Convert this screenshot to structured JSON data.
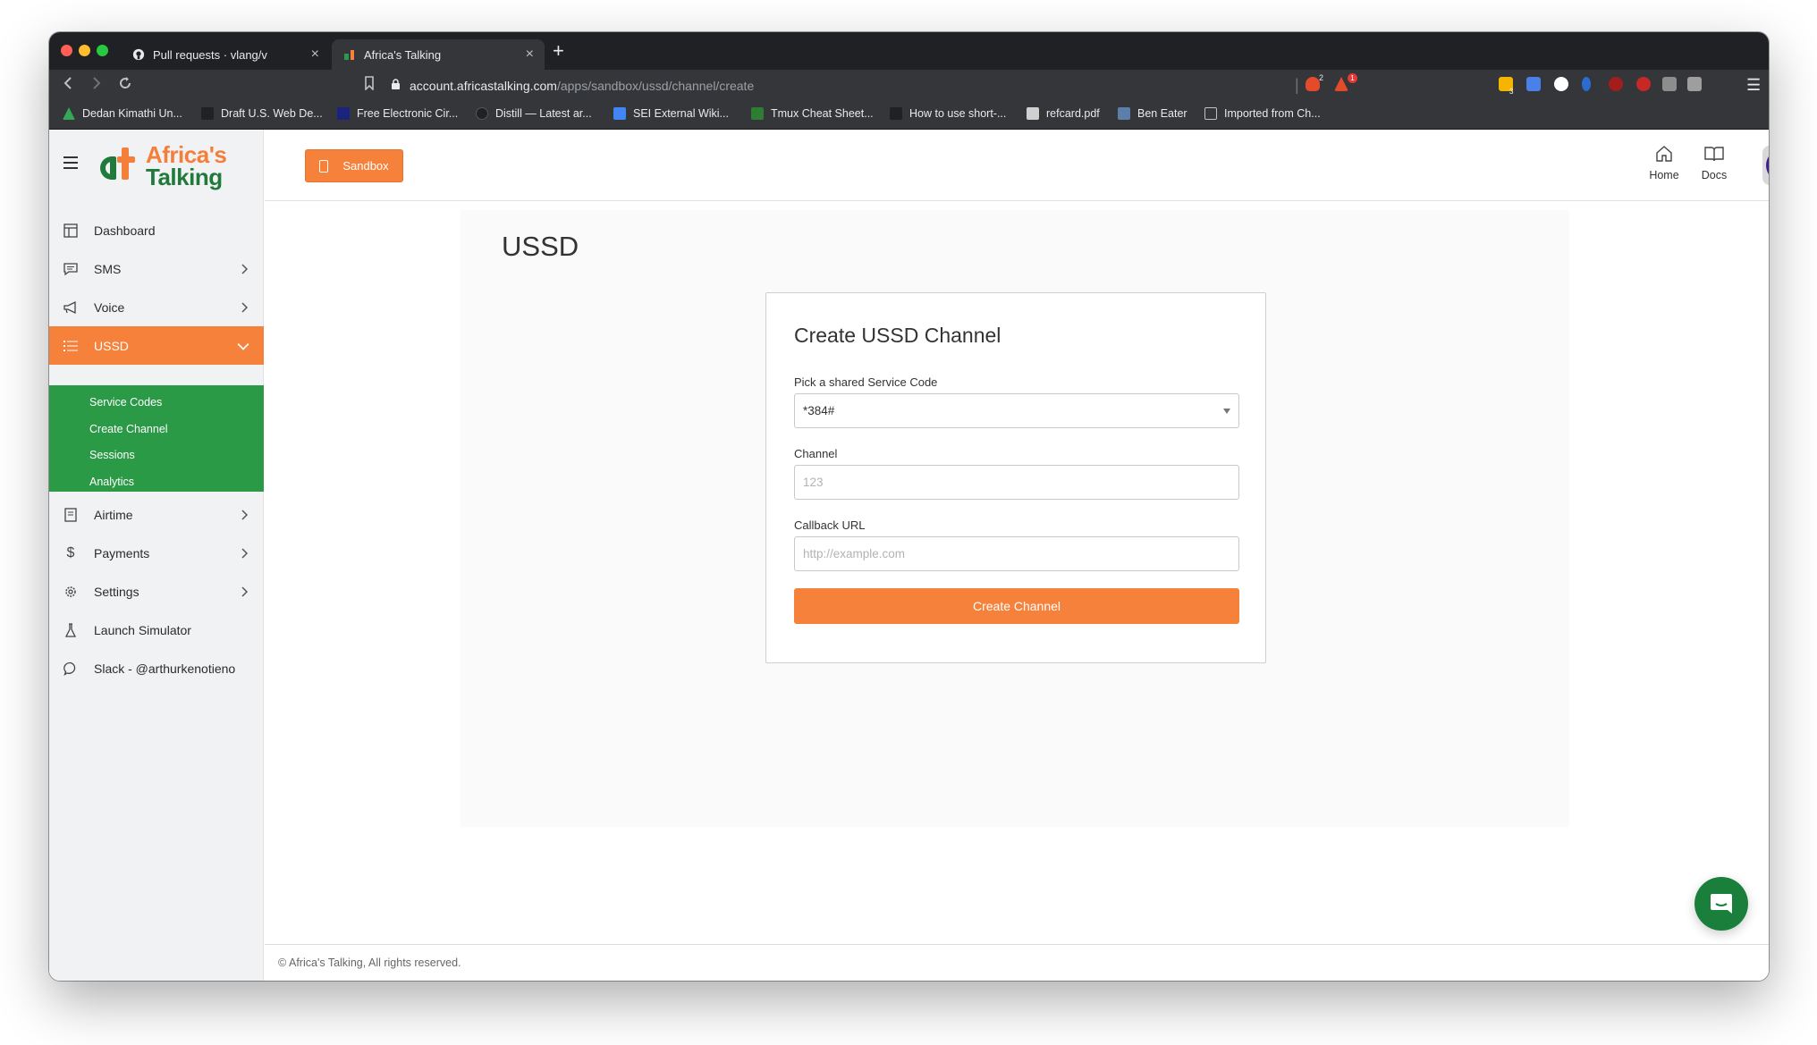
{
  "browser": {
    "tabs": [
      {
        "title": "Pull requests · vlang/v",
        "close": "×"
      },
      {
        "title": "Africa's Talking",
        "close": "×"
      }
    ],
    "new_tab": "+",
    "url_host": "account.africastalking.com",
    "url_path": "/apps/sandbox/ussd/channel/create",
    "bookmarks": [
      "Dedan Kimathi Un...",
      "Draft U.S. Web De...",
      "Free Electronic Cir...",
      "Distill — Latest ar...",
      "SEI External Wiki...",
      "Tmux Cheat Sheet...",
      "How to use short-...",
      "refcard.pdf",
      "Ben Eater",
      "Imported from Ch..."
    ],
    "extension_badges": {
      "brave": "2",
      "alert": "1",
      "ext_count": "3"
    }
  },
  "brand": {
    "line1": "Africa's",
    "line2": "Talking"
  },
  "sidebar": {
    "items": [
      {
        "label": "Dashboard",
        "icon": "dashboard-icon"
      },
      {
        "label": "SMS",
        "icon": "message-icon"
      },
      {
        "label": "Voice",
        "icon": "megaphone-icon"
      },
      {
        "label": "USSD",
        "icon": "list-icon"
      },
      {
        "label": "Airtime",
        "icon": "receipt-icon"
      },
      {
        "label": "Payments",
        "icon": "dollar-icon"
      },
      {
        "label": "Settings",
        "icon": "gear-icon"
      },
      {
        "label": "Launch Simulator",
        "icon": "flask-icon"
      },
      {
        "label": "Slack - @arthurkenotieno",
        "icon": "chat-icon"
      }
    ],
    "ussd_submenu": [
      "Service Codes",
      "Create Channel",
      "Sessions",
      "Analytics"
    ]
  },
  "topbar": {
    "sandbox_label": "Sandbox",
    "home_label": "Home",
    "docs_label": "Docs",
    "avatar_text": "<>"
  },
  "main": {
    "page_title": "USSD",
    "form": {
      "title": "Create USSD Channel",
      "service_code_label": "Pick a shared Service Code",
      "service_code_value": "*384#",
      "channel_label": "Channel",
      "channel_placeholder": "123",
      "callback_label": "Callback URL",
      "callback_placeholder": "http://example.com",
      "submit_label": "Create Channel"
    }
  },
  "footer": {
    "text": "© Africa's Talking, All rights reserved."
  },
  "colors": {
    "accent_orange": "#f6813b",
    "brand_green": "#2b9a47",
    "chrome_dark": "#202124"
  }
}
